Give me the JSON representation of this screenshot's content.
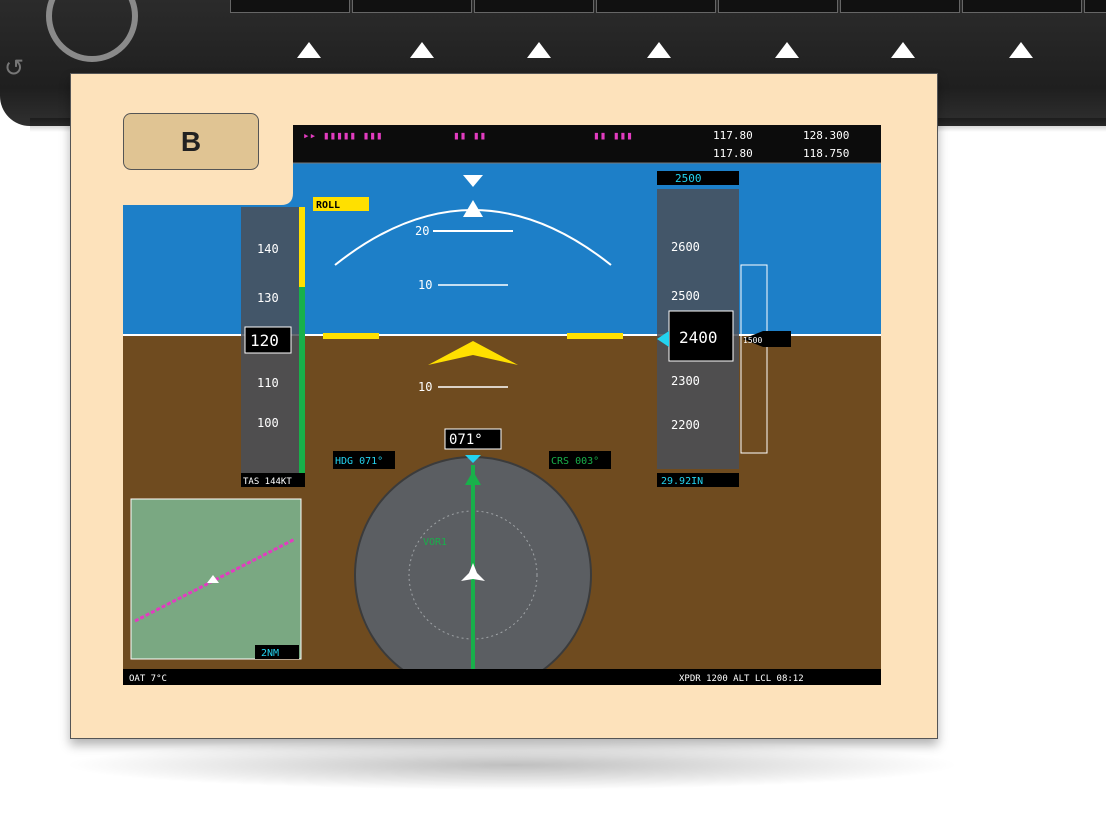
{
  "callout": {
    "label": "B"
  },
  "colors": {
    "panel": "#fde2bb",
    "marker": "#e0c493",
    "sky": "#1d7fc8",
    "ground": "#6f4b1f",
    "magenta": "#e23cc0",
    "cyan": "#23d3f0",
    "green": "#18b04a",
    "yellow": "#ffe000"
  },
  "softkeys": [
    {
      "label": ""
    },
    {
      "label": ""
    },
    {
      "label": ""
    },
    {
      "label": ""
    },
    {
      "label": ""
    },
    {
      "label": ""
    },
    {
      "label": ""
    },
    {
      "label": ""
    }
  ],
  "pfd": {
    "nav_bar": {
      "nav_freqs": [
        "117.80",
        "117.80"
      ],
      "com_freqs": [
        "128.300",
        "118.750"
      ]
    },
    "ap_status": "ROLL",
    "airspeed": {
      "current": "120",
      "ticks": [
        "140",
        "130",
        "110",
        "100"
      ],
      "tas": "TAS 144KT"
    },
    "pitch": {
      "marks": [
        "20",
        "10",
        "10"
      ]
    },
    "altitude": {
      "selected": "2500",
      "current": "2400",
      "ticks": [
        "2600",
        "2500",
        "2300",
        "2200"
      ],
      "baro": "29.92IN"
    },
    "heading": {
      "current": "071°",
      "hdg": "HDG 071°",
      "crs": "CRS 003°",
      "course_label": "VOR1"
    },
    "inset_map": {
      "range": "2NM"
    },
    "vsi_bug": "1500",
    "bottom_left": "OAT 7°C",
    "bottom_right": "XPDR 1200 ALT  LCL 08:12"
  }
}
